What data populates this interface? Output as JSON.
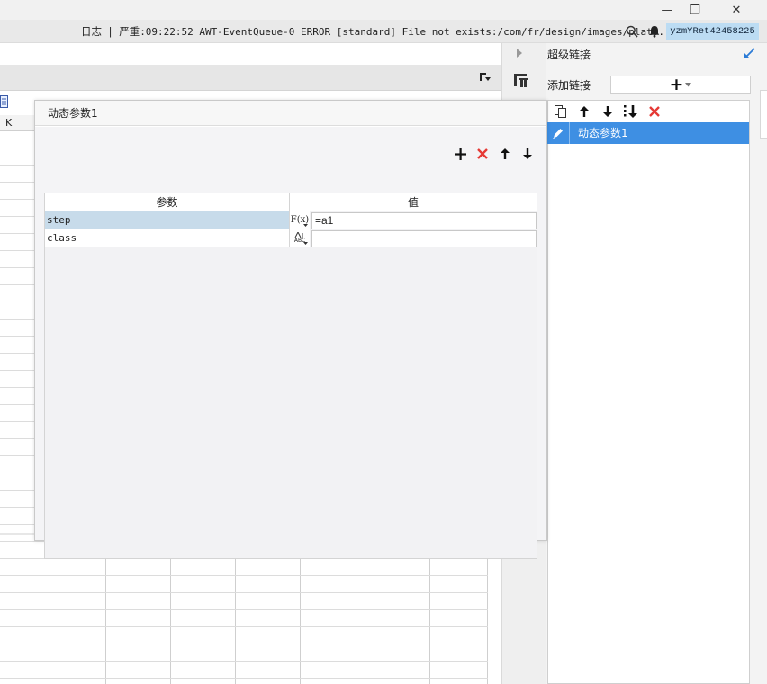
{
  "window": {
    "minimize_glyph": "—",
    "restore_glyph": "❐",
    "close_glyph": "✕"
  },
  "logbar": {
    "label": "日志",
    "separator": "|",
    "severity": "严重",
    "message": ":09:22:52 AWT-EventQueue-0 ERROR [standard] File not exists:/com/fr/design/images/plat...",
    "search_icon": "search-icon",
    "bell_icon": "bell-icon",
    "username": "yzmYRet42458225"
  },
  "sheet": {
    "visible_column": "K"
  },
  "link_panel": {
    "title": "超级链接",
    "add_label": "添加链接",
    "add_button_glyph": "+",
    "items": [
      {
        "label": "动态参数1",
        "selected": true
      }
    ]
  },
  "dialog": {
    "title": "动态参数1",
    "table": {
      "headers": [
        "参数",
        "值"
      ],
      "rows": [
        {
          "name": "step",
          "type": "formula",
          "type_label": "F(x)",
          "value": "=a1",
          "selected": true
        },
        {
          "name": "class",
          "type": "string",
          "type_label": "ABC",
          "value": "",
          "selected": false
        }
      ]
    }
  },
  "colors": {
    "accent": "#3e8fe3",
    "selected_row": "#c7dbea",
    "delete_red": "#e53935",
    "user_chip": "#bcdcf3"
  }
}
